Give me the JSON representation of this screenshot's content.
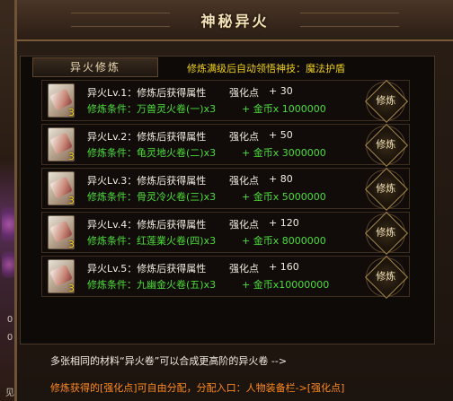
{
  "window": {
    "title": "神秘异火"
  },
  "tab": {
    "label": "异火修炼"
  },
  "hint": "修炼满级后自动领悟神技：魔法护盾",
  "practice_label": "修炼",
  "rows": [
    {
      "name": "异火Lv.1：修炼后获得属性",
      "attr": "强化点",
      "value": "+ 30",
      "cond": "修炼条件：万兽灵火卷(一)x3",
      "gold": "+  金币x 1000000",
      "qty": "3"
    },
    {
      "name": "异火Lv.2：修炼后获得属性",
      "attr": "强化点",
      "value": "+ 50",
      "cond": "修炼条件：龟灵地火卷(二)x3",
      "gold": "+  金币x 3000000",
      "qty": "3"
    },
    {
      "name": "异火Lv.3：修炼后获得属性",
      "attr": "强化点",
      "value": "+ 80",
      "cond": "修炼条件：骨灵冷火卷(三)x3",
      "gold": "+  金币x 5000000",
      "qty": "3"
    },
    {
      "name": "异火Lv.4：修炼后获得属性",
      "attr": "强化点",
      "value": "+ 120",
      "cond": "修炼条件：红莲業火卷(四)x3",
      "gold": "+  金币x 8000000",
      "qty": "3"
    },
    {
      "name": "异火Lv.5：修炼后获得属性",
      "attr": "强化点",
      "value": "+ 160",
      "cond": "修炼条件：九幽金火卷(五)x3",
      "gold": "+  金币x10000000",
      "qty": "3"
    }
  ],
  "footer": {
    "line1": "多张相同的材料“异火卷”可以合成更高阶的异火卷 -->",
    "line2": "修炼获得的[强化点]可自由分配，分配入口：人物装备栏->[强化点]"
  },
  "left_strip": {
    "chars": [
      "0",
      "0",
      "见"
    ]
  }
}
